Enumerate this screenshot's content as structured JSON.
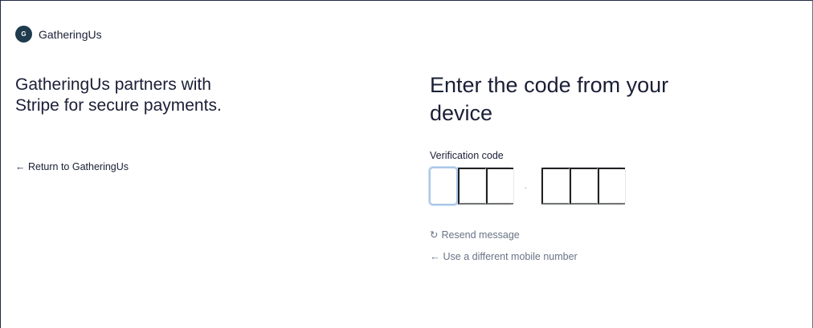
{
  "brand": {
    "logo_text": "G",
    "name": "GatheringUs"
  },
  "left": {
    "tagline": "GatheringUs partners with Stripe for secure payments.",
    "return_link": "← Return to GatheringUs"
  },
  "verification": {
    "heading": "Enter the code from your device",
    "label": "Verification code",
    "separator": "-",
    "digits": [
      "",
      "",
      "",
      "",
      "",
      ""
    ]
  },
  "actions": {
    "resend_icon": "↻",
    "resend_label": "Resend message",
    "different_icon": "←",
    "different_label": "Use a different mobile number"
  },
  "colors": {
    "text": "#1a1f36",
    "muted": "#697386",
    "focus_border": "#a9c7e8",
    "input_border": "#e3e8ee"
  }
}
